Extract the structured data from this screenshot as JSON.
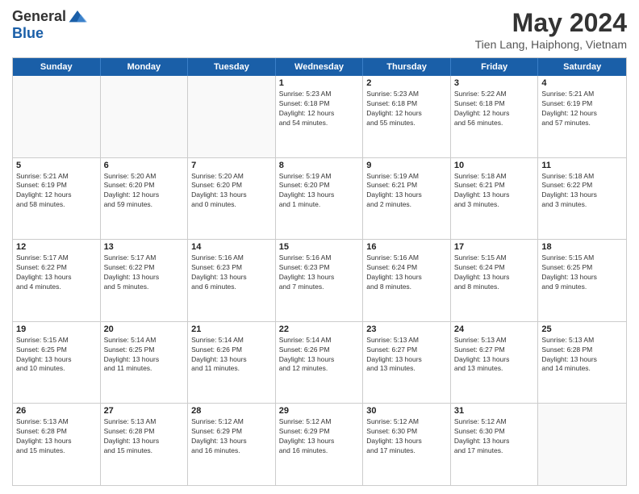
{
  "header": {
    "logo_general": "General",
    "logo_blue": "Blue",
    "title": "May 2024",
    "subtitle": "Tien Lang, Haiphong, Vietnam"
  },
  "weekdays": [
    "Sunday",
    "Monday",
    "Tuesday",
    "Wednesday",
    "Thursday",
    "Friday",
    "Saturday"
  ],
  "rows": [
    [
      {
        "day": "",
        "info": "",
        "empty": true
      },
      {
        "day": "",
        "info": "",
        "empty": true
      },
      {
        "day": "",
        "info": "",
        "empty": true
      },
      {
        "day": "1",
        "info": "Sunrise: 5:23 AM\nSunset: 6:18 PM\nDaylight: 12 hours\nand 54 minutes.",
        "empty": false
      },
      {
        "day": "2",
        "info": "Sunrise: 5:23 AM\nSunset: 6:18 PM\nDaylight: 12 hours\nand 55 minutes.",
        "empty": false
      },
      {
        "day": "3",
        "info": "Sunrise: 5:22 AM\nSunset: 6:18 PM\nDaylight: 12 hours\nand 56 minutes.",
        "empty": false
      },
      {
        "day": "4",
        "info": "Sunrise: 5:21 AM\nSunset: 6:19 PM\nDaylight: 12 hours\nand 57 minutes.",
        "empty": false
      }
    ],
    [
      {
        "day": "5",
        "info": "Sunrise: 5:21 AM\nSunset: 6:19 PM\nDaylight: 12 hours\nand 58 minutes.",
        "empty": false
      },
      {
        "day": "6",
        "info": "Sunrise: 5:20 AM\nSunset: 6:20 PM\nDaylight: 12 hours\nand 59 minutes.",
        "empty": false
      },
      {
        "day": "7",
        "info": "Sunrise: 5:20 AM\nSunset: 6:20 PM\nDaylight: 13 hours\nand 0 minutes.",
        "empty": false
      },
      {
        "day": "8",
        "info": "Sunrise: 5:19 AM\nSunset: 6:20 PM\nDaylight: 13 hours\nand 1 minute.",
        "empty": false
      },
      {
        "day": "9",
        "info": "Sunrise: 5:19 AM\nSunset: 6:21 PM\nDaylight: 13 hours\nand 2 minutes.",
        "empty": false
      },
      {
        "day": "10",
        "info": "Sunrise: 5:18 AM\nSunset: 6:21 PM\nDaylight: 13 hours\nand 3 minutes.",
        "empty": false
      },
      {
        "day": "11",
        "info": "Sunrise: 5:18 AM\nSunset: 6:22 PM\nDaylight: 13 hours\nand 3 minutes.",
        "empty": false
      }
    ],
    [
      {
        "day": "12",
        "info": "Sunrise: 5:17 AM\nSunset: 6:22 PM\nDaylight: 13 hours\nand 4 minutes.",
        "empty": false
      },
      {
        "day": "13",
        "info": "Sunrise: 5:17 AM\nSunset: 6:22 PM\nDaylight: 13 hours\nand 5 minutes.",
        "empty": false
      },
      {
        "day": "14",
        "info": "Sunrise: 5:16 AM\nSunset: 6:23 PM\nDaylight: 13 hours\nand 6 minutes.",
        "empty": false
      },
      {
        "day": "15",
        "info": "Sunrise: 5:16 AM\nSunset: 6:23 PM\nDaylight: 13 hours\nand 7 minutes.",
        "empty": false
      },
      {
        "day": "16",
        "info": "Sunrise: 5:16 AM\nSunset: 6:24 PM\nDaylight: 13 hours\nand 8 minutes.",
        "empty": false
      },
      {
        "day": "17",
        "info": "Sunrise: 5:15 AM\nSunset: 6:24 PM\nDaylight: 13 hours\nand 8 minutes.",
        "empty": false
      },
      {
        "day": "18",
        "info": "Sunrise: 5:15 AM\nSunset: 6:25 PM\nDaylight: 13 hours\nand 9 minutes.",
        "empty": false
      }
    ],
    [
      {
        "day": "19",
        "info": "Sunrise: 5:15 AM\nSunset: 6:25 PM\nDaylight: 13 hours\nand 10 minutes.",
        "empty": false
      },
      {
        "day": "20",
        "info": "Sunrise: 5:14 AM\nSunset: 6:25 PM\nDaylight: 13 hours\nand 11 minutes.",
        "empty": false
      },
      {
        "day": "21",
        "info": "Sunrise: 5:14 AM\nSunset: 6:26 PM\nDaylight: 13 hours\nand 11 minutes.",
        "empty": false
      },
      {
        "day": "22",
        "info": "Sunrise: 5:14 AM\nSunset: 6:26 PM\nDaylight: 13 hours\nand 12 minutes.",
        "empty": false
      },
      {
        "day": "23",
        "info": "Sunrise: 5:13 AM\nSunset: 6:27 PM\nDaylight: 13 hours\nand 13 minutes.",
        "empty": false
      },
      {
        "day": "24",
        "info": "Sunrise: 5:13 AM\nSunset: 6:27 PM\nDaylight: 13 hours\nand 13 minutes.",
        "empty": false
      },
      {
        "day": "25",
        "info": "Sunrise: 5:13 AM\nSunset: 6:28 PM\nDaylight: 13 hours\nand 14 minutes.",
        "empty": false
      }
    ],
    [
      {
        "day": "26",
        "info": "Sunrise: 5:13 AM\nSunset: 6:28 PM\nDaylight: 13 hours\nand 15 minutes.",
        "empty": false
      },
      {
        "day": "27",
        "info": "Sunrise: 5:13 AM\nSunset: 6:28 PM\nDaylight: 13 hours\nand 15 minutes.",
        "empty": false
      },
      {
        "day": "28",
        "info": "Sunrise: 5:12 AM\nSunset: 6:29 PM\nDaylight: 13 hours\nand 16 minutes.",
        "empty": false
      },
      {
        "day": "29",
        "info": "Sunrise: 5:12 AM\nSunset: 6:29 PM\nDaylight: 13 hours\nand 16 minutes.",
        "empty": false
      },
      {
        "day": "30",
        "info": "Sunrise: 5:12 AM\nSunset: 6:30 PM\nDaylight: 13 hours\nand 17 minutes.",
        "empty": false
      },
      {
        "day": "31",
        "info": "Sunrise: 5:12 AM\nSunset: 6:30 PM\nDaylight: 13 hours\nand 17 minutes.",
        "empty": false
      },
      {
        "day": "",
        "info": "",
        "empty": true
      }
    ]
  ]
}
